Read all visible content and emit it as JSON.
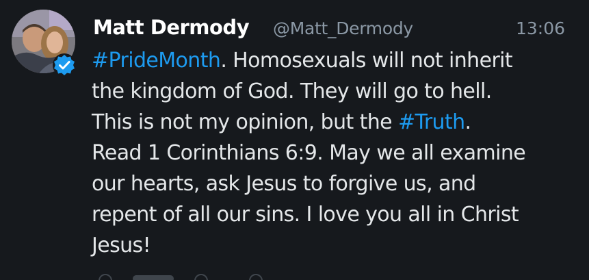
{
  "tweet": {
    "name": "Matt Dermody",
    "handle": "@Matt_Dermody",
    "time": "13:06",
    "lines": [
      {
        "pre": "",
        "tag": "#PrideMonth",
        "post": ". Homosexuals will not inherit"
      },
      {
        "pre": "the kingdom of God. They will go to hell.",
        "tag": "",
        "post": ""
      },
      {
        "pre": "This is not my opinion, but the ",
        "tag": "#Truth",
        "post": "."
      },
      {
        "pre": "Read 1 Corinthians 6:9. May we all examine",
        "tag": "",
        "post": ""
      },
      {
        "pre": "our hearts, ask Jesus to forgive us, and",
        "tag": "",
        "post": ""
      },
      {
        "pre": "repent of all our sins. I love you all in Christ",
        "tag": "",
        "post": ""
      },
      {
        "pre": "Jesus!",
        "tag": "",
        "post": ""
      }
    ],
    "verified": true
  },
  "colors": {
    "background": "#16191d",
    "text": "#e4e7e9",
    "muted": "#8b98a5",
    "hashtag": "#1d9bf0",
    "verified_badge": "#1d9bf0"
  },
  "icons": {
    "avatar": "profile-photo",
    "badge": "verified-badge-icon"
  }
}
